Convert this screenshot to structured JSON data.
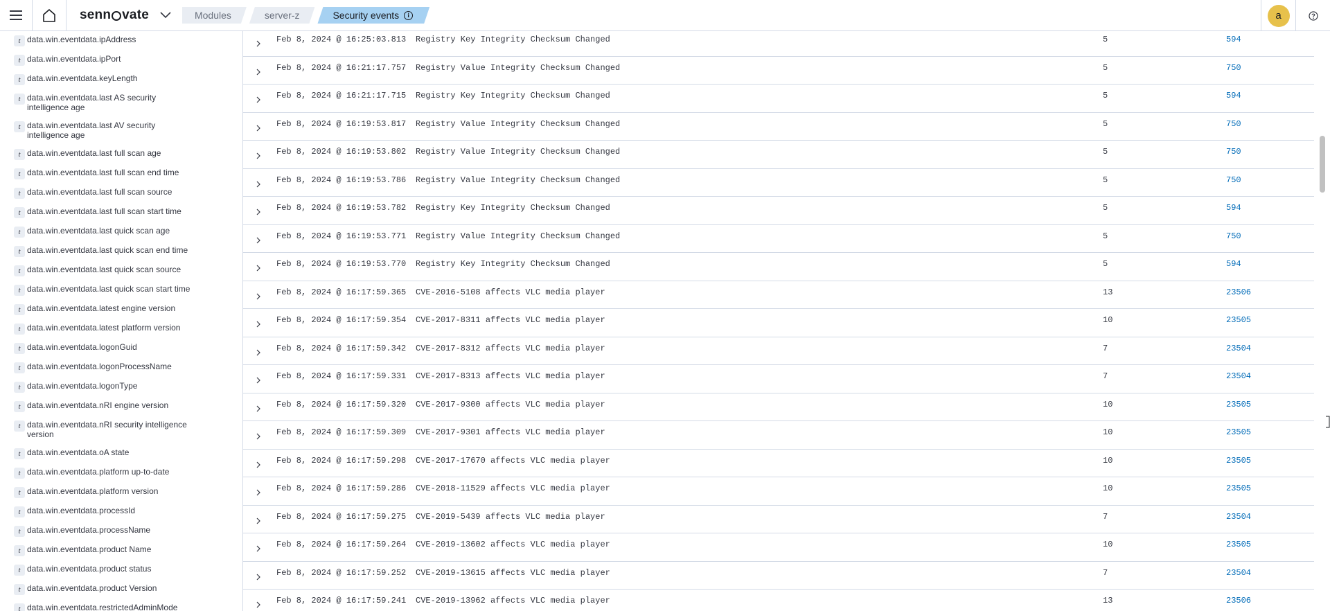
{
  "header": {
    "logo_text": "sennovate",
    "breadcrumbs": [
      "Modules",
      "server-z",
      "Security events"
    ],
    "active_crumb_info": "i",
    "avatar_letter": "a",
    "icons": [
      "menu-icon",
      "home-icon",
      "chevron-down-icon",
      "info-icon",
      "help-icon"
    ]
  },
  "sidebar": {
    "type_token": "t",
    "fields": [
      "data.win.eventdata.ipAddress",
      "data.win.eventdata.ipPort",
      "data.win.eventdata.keyLength",
      "data.win.eventdata.last AS security intelligence age",
      "data.win.eventdata.last AV security intelligence age",
      "data.win.eventdata.last full scan age",
      "data.win.eventdata.last full scan end time",
      "data.win.eventdata.last full scan source",
      "data.win.eventdata.last full scan start time",
      "data.win.eventdata.last quick scan age",
      "data.win.eventdata.last quick scan end time",
      "data.win.eventdata.last quick scan source",
      "data.win.eventdata.last quick scan start time",
      "data.win.eventdata.latest engine version",
      "data.win.eventdata.latest platform version",
      "data.win.eventdata.logonGuid",
      "data.win.eventdata.logonProcessName",
      "data.win.eventdata.logonType",
      "data.win.eventdata.nRI engine version",
      "data.win.eventdata.nRI security intelligence version",
      "data.win.eventdata.oA state",
      "data.win.eventdata.platform up-to-date",
      "data.win.eventdata.platform version",
      "data.win.eventdata.processId",
      "data.win.eventdata.processName",
      "data.win.eventdata.product Name",
      "data.win.eventdata.product status",
      "data.win.eventdata.product Version",
      "data.win.eventdata.restrictedAdminMode"
    ]
  },
  "events": [
    {
      "timestamp": "Feb 8, 2024 @ 16:25:03.813",
      "description": "Registry Key Integrity Checksum Changed",
      "level": "5",
      "rule_id": "594"
    },
    {
      "timestamp": "Feb 8, 2024 @ 16:21:17.757",
      "description": "Registry Value Integrity Checksum Changed",
      "level": "5",
      "rule_id": "750"
    },
    {
      "timestamp": "Feb 8, 2024 @ 16:21:17.715",
      "description": "Registry Key Integrity Checksum Changed",
      "level": "5",
      "rule_id": "594"
    },
    {
      "timestamp": "Feb 8, 2024 @ 16:19:53.817",
      "description": "Registry Value Integrity Checksum Changed",
      "level": "5",
      "rule_id": "750"
    },
    {
      "timestamp": "Feb 8, 2024 @ 16:19:53.802",
      "description": "Registry Value Integrity Checksum Changed",
      "level": "5",
      "rule_id": "750"
    },
    {
      "timestamp": "Feb 8, 2024 @ 16:19:53.786",
      "description": "Registry Value Integrity Checksum Changed",
      "level": "5",
      "rule_id": "750"
    },
    {
      "timestamp": "Feb 8, 2024 @ 16:19:53.782",
      "description": "Registry Key Integrity Checksum Changed",
      "level": "5",
      "rule_id": "594"
    },
    {
      "timestamp": "Feb 8, 2024 @ 16:19:53.771",
      "description": "Registry Value Integrity Checksum Changed",
      "level": "5",
      "rule_id": "750"
    },
    {
      "timestamp": "Feb 8, 2024 @ 16:19:53.770",
      "description": "Registry Key Integrity Checksum Changed",
      "level": "5",
      "rule_id": "594"
    },
    {
      "timestamp": "Feb 8, 2024 @ 16:17:59.365",
      "description": "CVE-2016-5108 affects VLC media player",
      "level": "13",
      "rule_id": "23506"
    },
    {
      "timestamp": "Feb 8, 2024 @ 16:17:59.354",
      "description": "CVE-2017-8311 affects VLC media player",
      "level": "10",
      "rule_id": "23505"
    },
    {
      "timestamp": "Feb 8, 2024 @ 16:17:59.342",
      "description": "CVE-2017-8312 affects VLC media player",
      "level": "7",
      "rule_id": "23504"
    },
    {
      "timestamp": "Feb 8, 2024 @ 16:17:59.331",
      "description": "CVE-2017-8313 affects VLC media player",
      "level": "7",
      "rule_id": "23504"
    },
    {
      "timestamp": "Feb 8, 2024 @ 16:17:59.320",
      "description": "CVE-2017-9300 affects VLC media player",
      "level": "10",
      "rule_id": "23505"
    },
    {
      "timestamp": "Feb 8, 2024 @ 16:17:59.309",
      "description": "CVE-2017-9301 affects VLC media player",
      "level": "10",
      "rule_id": "23505"
    },
    {
      "timestamp": "Feb 8, 2024 @ 16:17:59.298",
      "description": "CVE-2017-17670 affects VLC media player",
      "level": "10",
      "rule_id": "23505"
    },
    {
      "timestamp": "Feb 8, 2024 @ 16:17:59.286",
      "description": "CVE-2018-11529 affects VLC media player",
      "level": "10",
      "rule_id": "23505"
    },
    {
      "timestamp": "Feb 8, 2024 @ 16:17:59.275",
      "description": "CVE-2019-5439 affects VLC media player",
      "level": "7",
      "rule_id": "23504"
    },
    {
      "timestamp": "Feb 8, 2024 @ 16:17:59.264",
      "description": "CVE-2019-13602 affects VLC media player",
      "level": "10",
      "rule_id": "23505"
    },
    {
      "timestamp": "Feb 8, 2024 @ 16:17:59.252",
      "description": "CVE-2019-13615 affects VLC media player",
      "level": "7",
      "rule_id": "23504"
    },
    {
      "timestamp": "Feb 8, 2024 @ 16:17:59.241",
      "description": "CVE-2019-13962 affects VLC media player",
      "level": "13",
      "rule_id": "23506"
    }
  ]
}
